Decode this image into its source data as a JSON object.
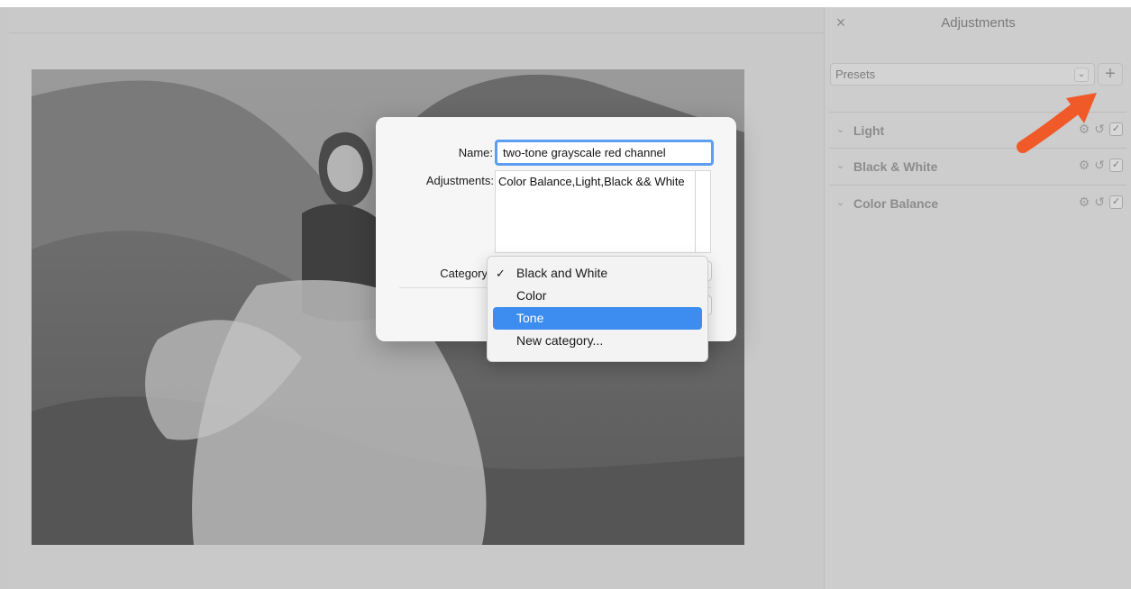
{
  "panel": {
    "title": "Adjustments",
    "close_icon": "close-icon",
    "presets_label": "Presets",
    "add_label": "+",
    "sections": [
      {
        "name": "Light"
      },
      {
        "name": "Black & White"
      },
      {
        "name": "Color Balance"
      }
    ]
  },
  "dialog": {
    "name_label": "Name:",
    "name_value": "two-tone grayscale red channel",
    "adjustments_label": "Adjustments:",
    "adjustments_value": "Color Balance,Light,Black && White",
    "category_label": "Category"
  },
  "menu": {
    "items": [
      {
        "label": "Black and White",
        "checked": true
      },
      {
        "label": "Color",
        "checked": false
      },
      {
        "label": "Tone",
        "checked": false
      },
      {
        "label": "New category...",
        "checked": false
      }
    ],
    "highlighted": "Tone"
  },
  "colors": {
    "accent": "#3d8cf0",
    "focus_ring": "#5e9ef2",
    "annotation_arrow": "#f05a28"
  }
}
